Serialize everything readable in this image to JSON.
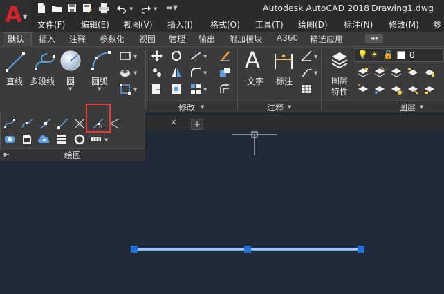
{
  "app": {
    "logo_letter": "A",
    "title": "Autodesk AutoCAD 2018",
    "document": "Drawing1.dwg"
  },
  "menu": [
    "文件(F)",
    "编辑(E)",
    "视图(V)",
    "插入(I)",
    "格式(O)",
    "工具(T)",
    "绘图(D)",
    "标注(N)",
    "修改(M)",
    "参"
  ],
  "ribbon_tabs": [
    "默认",
    "插入",
    "注释",
    "参数化",
    "视图",
    "管理",
    "输出",
    "附加模块",
    "A360",
    "精选应用"
  ],
  "draw_panel": {
    "tools": [
      "直线",
      "多段线",
      "圆",
      "圆弧"
    ],
    "title": "绘图"
  },
  "modify_panel": {
    "title": "修改"
  },
  "annotation_panel": {
    "tools": [
      "文字",
      "标注"
    ],
    "title": "注释"
  },
  "layers_panel": {
    "tool": "图层\n特性",
    "layer_value": "0",
    "title": "图层"
  },
  "file_tab": {
    "close": "×",
    "add": "+"
  },
  "colors": {
    "accent": "#1e6fd9",
    "logo": "#d4222a",
    "highlight": "#e53a3a",
    "canvas": "#212a38"
  }
}
